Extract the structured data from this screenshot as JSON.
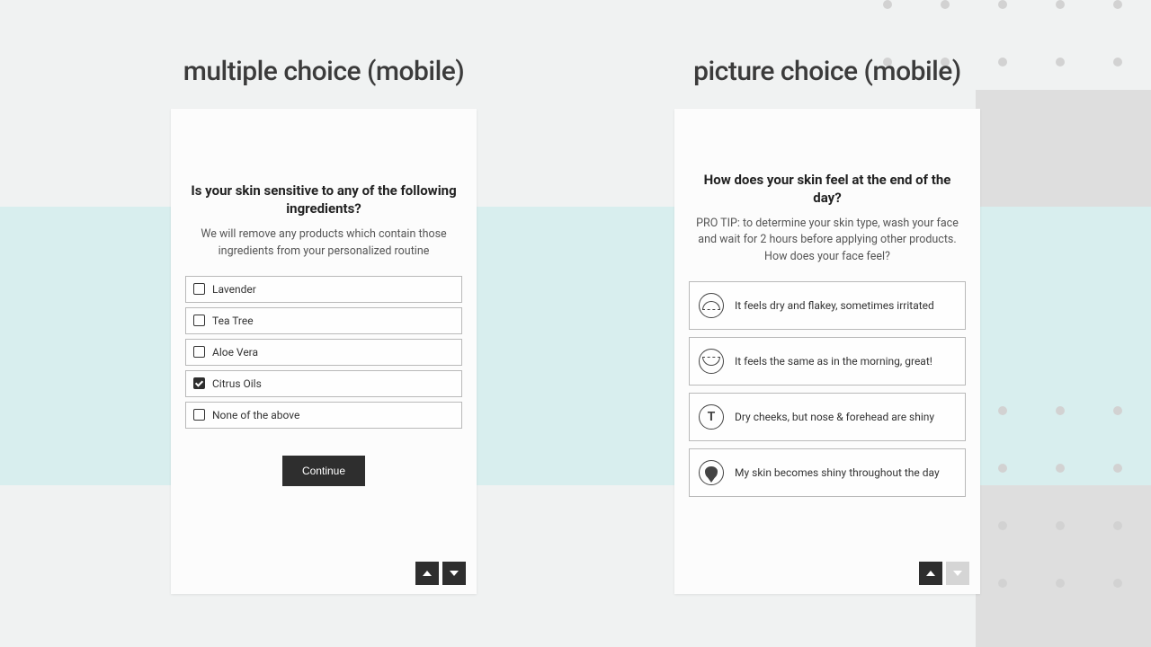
{
  "left": {
    "title": "multiple choice (mobile)",
    "question": "Is your skin sensitive to any of the following ingredients?",
    "subtext": "We will remove any products which contain those ingredients from your personalized routine",
    "options": [
      {
        "label": "Lavender",
        "checked": false
      },
      {
        "label": "Tea Tree",
        "checked": false
      },
      {
        "label": "Aloe Vera",
        "checked": false
      },
      {
        "label": "Citrus Oils",
        "checked": true
      },
      {
        "label": "None of the above",
        "checked": false
      }
    ],
    "continue": "Continue"
  },
  "right": {
    "title": "picture choice (mobile)",
    "question": "How does your skin feel at the end of the day?",
    "subtext": "PRO TIP: to determine your skin type, wash your face and wait for 2 hours before applying other products. How does your face feel?",
    "options": [
      {
        "label": "It feels dry and flakey, sometimes irritated",
        "icon": "dry"
      },
      {
        "label": "It feels the same as in the morning, great!",
        "icon": "normal"
      },
      {
        "label": "Dry cheeks, but nose & forehead are shiny",
        "icon": "combo"
      },
      {
        "label": "My skin becomes shiny throughout the day",
        "icon": "oily"
      }
    ]
  }
}
